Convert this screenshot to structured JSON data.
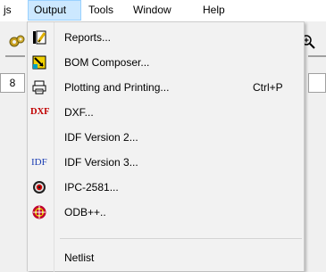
{
  "menubar": {
    "items": [
      {
        "label": "js"
      },
      {
        "label": "Output"
      },
      {
        "label": "Tools"
      },
      {
        "label": "Window"
      },
      {
        "label": "Help"
      }
    ]
  },
  "ruler": {
    "left_value": "8"
  },
  "dropdown": {
    "items": [
      {
        "label": "Reports...",
        "icon": "reports-icon"
      },
      {
        "label": "BOM Composer...",
        "icon": "bom-composer-icon"
      },
      {
        "label": "Plotting and Printing...",
        "shortcut": "Ctrl+P",
        "icon": "printer-icon"
      },
      {
        "label": "DXF...",
        "icon_text": "DXF",
        "icon": "dxf-icon"
      },
      {
        "label": "IDF Version 2...",
        "icon": "none"
      },
      {
        "label": "IDF Version 3...",
        "icon_text": "IDF",
        "icon": "idf-icon"
      },
      {
        "label": "IPC-2581...",
        "icon": "ipc-icon"
      },
      {
        "label": "ODB++..",
        "icon": "odb-icon"
      },
      {
        "label": "Netlist",
        "icon": "none"
      }
    ]
  },
  "colors": {
    "active_menu_bg": "#cce8ff",
    "active_menu_border": "#99d1ff",
    "dropdown_bg": "#f2f2f2",
    "dxf_icon": "#c00000",
    "idf_icon": "#1a3db3"
  }
}
